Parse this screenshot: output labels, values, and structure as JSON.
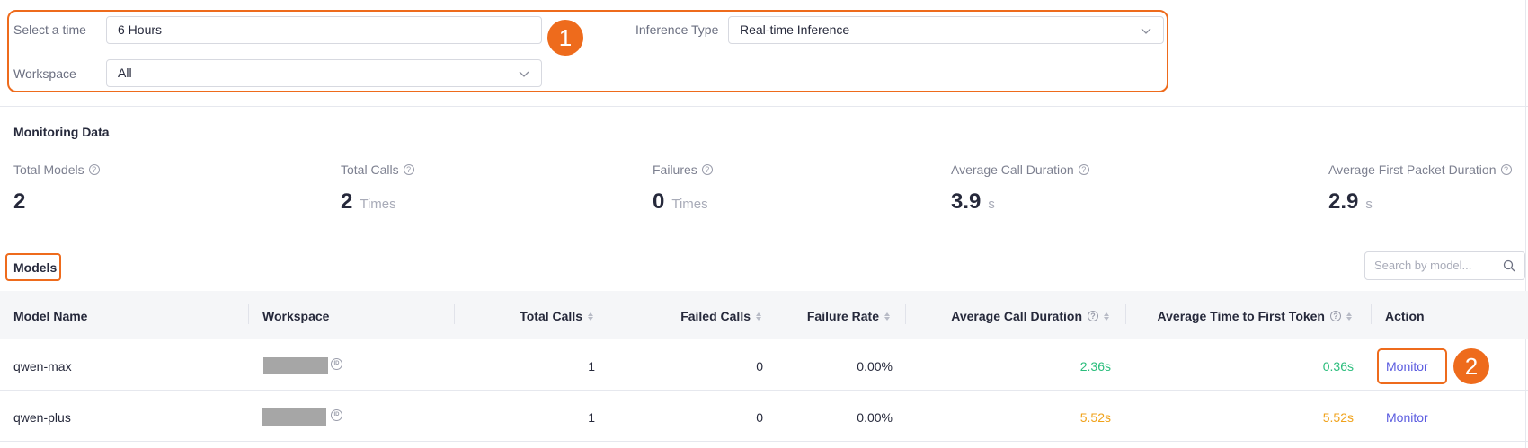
{
  "filters": {
    "time_label": "Select a time",
    "time_value": "6 Hours",
    "inference_label": "Inference Type",
    "inference_value": "Real-time Inference",
    "workspace_label": "Workspace",
    "workspace_value": "All"
  },
  "callouts": {
    "one": "1",
    "two": "2"
  },
  "monitoring": {
    "title": "Monitoring Data",
    "stats": [
      {
        "label": "Total Models",
        "value": "2",
        "unit": ""
      },
      {
        "label": "Total Calls",
        "value": "2",
        "unit": "Times"
      },
      {
        "label": "Failures",
        "value": "0",
        "unit": "Times"
      },
      {
        "label": "Average Call Duration",
        "value": "3.9",
        "unit": "s"
      },
      {
        "label": "Average First Packet Duration",
        "value": "2.9",
        "unit": "s"
      }
    ]
  },
  "models": {
    "title": "Models",
    "search_placeholder": "Search by model...",
    "columns": [
      "Model Name",
      "Workspace",
      "Total Calls",
      "Failed Calls",
      "Failure Rate",
      "Average Call Duration",
      "Average Time to First Token",
      "Action"
    ],
    "rows": [
      {
        "name": "qwen-max",
        "total_calls": "1",
        "failed_calls": "0",
        "failure_rate": "0.00%",
        "avg_duration": "2.36s",
        "ttft": "0.36s",
        "action": "Monitor"
      },
      {
        "name": "qwen-plus",
        "total_calls": "1",
        "failed_calls": "0",
        "failure_rate": "0.00%",
        "avg_duration": "5.52s",
        "ttft": "5.52s",
        "action": "Monitor"
      }
    ]
  },
  "colors": {
    "accent": "#ee6b1c",
    "link": "#5b5ce0",
    "good": "#2bbd7c",
    "warn": "#f0a21a"
  },
  "icons": {
    "help": "question-circle-icon",
    "dropdown": "chevron-down-icon",
    "search": "search-icon",
    "id": "id-icon"
  }
}
